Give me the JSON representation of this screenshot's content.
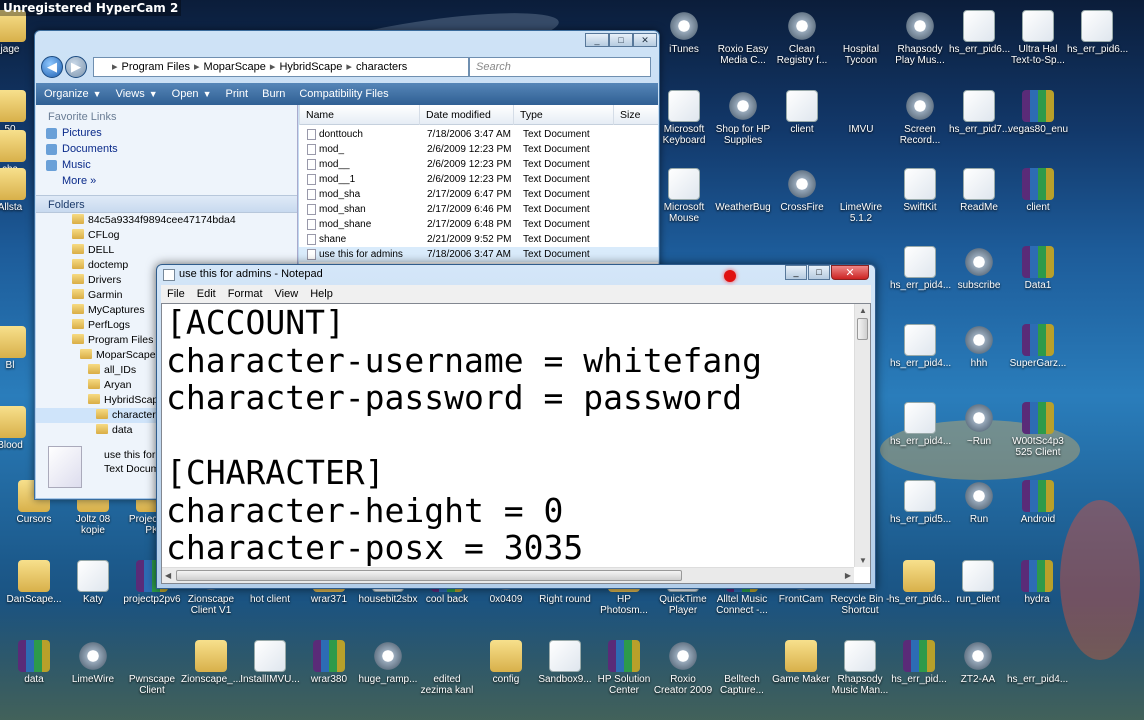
{
  "recorder": "Unregistered HyperCam 2",
  "explorer": {
    "breadcrumb": [
      "Program Files",
      "MoparScape",
      "HybridScape",
      "characters"
    ],
    "search_placeholder": "Search",
    "toolbar": [
      "Organize",
      "Views",
      "Open",
      "Print",
      "Burn",
      "Compatibility Files"
    ],
    "favorites_title": "Favorite Links",
    "favorites": [
      "Pictures",
      "Documents",
      "Music",
      "More"
    ],
    "folders_title": "Folders",
    "tree": [
      {
        "label": "84c5a9334f9894cee47174bda4",
        "indent": 0
      },
      {
        "label": "CFLog",
        "indent": 0
      },
      {
        "label": "DELL",
        "indent": 0
      },
      {
        "label": "doctemp",
        "indent": 0
      },
      {
        "label": "Drivers",
        "indent": 0
      },
      {
        "label": "Garmin",
        "indent": 0
      },
      {
        "label": "MyCaptures",
        "indent": 0
      },
      {
        "label": "PerfLogs",
        "indent": 0
      },
      {
        "label": "Program Files",
        "indent": 0
      },
      {
        "label": "MoparScape",
        "indent": 1
      },
      {
        "label": "all_IDs",
        "indent": 2
      },
      {
        "label": "Aryan",
        "indent": 2
      },
      {
        "label": "HybridScape",
        "indent": 2
      },
      {
        "label": "characters",
        "indent": 3
      },
      {
        "label": "data",
        "indent": 3
      }
    ],
    "columns": [
      "Name",
      "Date modified",
      "Type",
      "Size"
    ],
    "files": [
      {
        "name": "donttouch",
        "date": "7/18/2006 3:47 AM",
        "type": "Text Document"
      },
      {
        "name": "mod_",
        "date": "2/6/2009 12:23 PM",
        "type": "Text Document"
      },
      {
        "name": "mod__",
        "date": "2/6/2009 12:23 PM",
        "type": "Text Document"
      },
      {
        "name": "mod__1",
        "date": "2/6/2009 12:23 PM",
        "type": "Text Document"
      },
      {
        "name": "mod_sha",
        "date": "2/17/2009 6:47 PM",
        "type": "Text Document"
      },
      {
        "name": "mod_shan",
        "date": "2/17/2009 6:46 PM",
        "type": "Text Document"
      },
      {
        "name": "mod_shane",
        "date": "2/17/2009 6:48 PM",
        "type": "Text Document"
      },
      {
        "name": "shane",
        "date": "2/21/2009 9:52 PM",
        "type": "Text Document"
      },
      {
        "name": "use this for admins",
        "date": "7/18/2006 3:47 AM",
        "type": "Text Document"
      }
    ],
    "preview_name": "use this for",
    "preview_type": "Text Docume"
  },
  "notepad": {
    "title": "use this for admins - Notepad",
    "menus": [
      "File",
      "Edit",
      "Format",
      "View",
      "Help"
    ],
    "lines": [
      "[ACCOUNT]",
      "character-username = whitefang",
      "character-password = password",
      "",
      "[CHARACTER]",
      "character-height = 0",
      "character-posx = 3035"
    ]
  },
  "desktop_left_partial": [
    "jage",
    "50",
    "cha",
    "Allsta",
    "Bl",
    "Blood",
    "Cursors",
    "Joltz 08 kopie",
    "Project V6 PK"
  ],
  "desktop_row_bottom1": [
    "DanScape...",
    "Katy",
    "projectp2pv6",
    "Zionscape Client V1",
    "hot client",
    "wrar371",
    "housebit2sbx",
    "cool back",
    "0x0409",
    "Right round",
    "HP Photosm...",
    "QuickTime Player",
    "Alltel Music Connect -...",
    "FrontCam",
    "Recycle Bin - Shortcut",
    "hs_err_pid6...",
    "run_client",
    "hydra"
  ],
  "desktop_row_bottom2": [
    "data",
    "LimeWire",
    "Pwnscape Client",
    "Zionscape_...",
    "InstallIMVU...",
    "wrar380",
    "huge_ramp...",
    "edited zezima kanl",
    "config",
    "Sandbox9...",
    "HP Solution Center",
    "Roxio Creator 2009",
    "Belltech Capture...",
    "Game Maker",
    "Rhapsody Music Man...",
    "hs_err_pid...",
    "ZT2-AA",
    "hs_err_pid4..."
  ],
  "desktop_top_right": [
    "iTunes",
    "Roxio Easy Media C...",
    "Clean Registry f...",
    "Hospital Tycoon",
    "Rhapsody Play Mus...",
    "hs_err_pid6...",
    "Ultra Hal Text-to-Sp...",
    "hs_err_pid6..."
  ],
  "desktop_right_row2": [
    "Microsoft Keyboard",
    "Shop for HP Supplies",
    "client",
    "IMVU",
    "Screen Record...",
    "hs_err_pid7...",
    "vegas80_enu"
  ],
  "desktop_right_row3": [
    "Microsoft Mouse",
    "WeatherBug",
    "CrossFire",
    "LimeWire 5.1.2",
    "SwiftKit",
    "ReadMe",
    "client"
  ],
  "desktop_right_col": [
    "hs_err_pid4...",
    "subscribe",
    "Data1",
    "hs_err_pid4...",
    "hhh",
    "SuperGarz...",
    "hs_err_pid4...",
    "~Run",
    "W00tSc4p3 525 Client",
    "hs_err_pid5...",
    "Run",
    "Android"
  ]
}
